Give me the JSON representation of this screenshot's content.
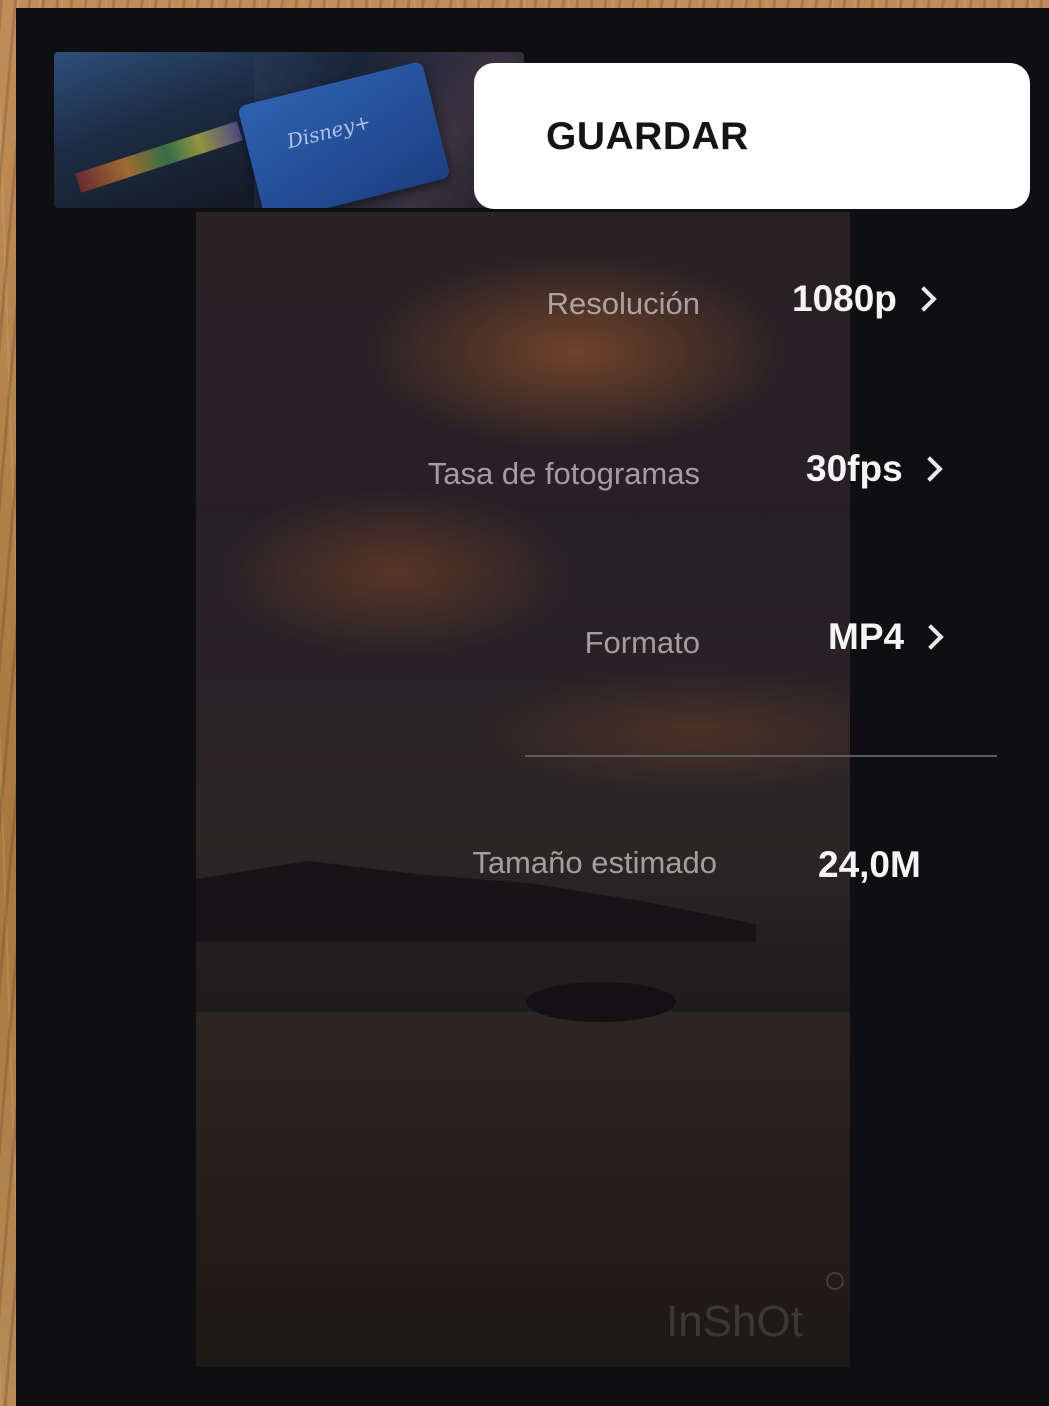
{
  "thumbnail": {
    "logo_text": "Disney+"
  },
  "save": {
    "label": "GUARDAR"
  },
  "settings": {
    "resolution": {
      "label": "Resolución",
      "value": "1080p"
    },
    "frame_rate": {
      "label": "Tasa de fotogramas",
      "value": "30fps"
    },
    "format": {
      "label": "Formato",
      "value": "MP4"
    },
    "estimated_size": {
      "label": "Tamaño estimado",
      "value": "24,0M"
    }
  },
  "preview": {
    "watermark": "InShOt"
  }
}
